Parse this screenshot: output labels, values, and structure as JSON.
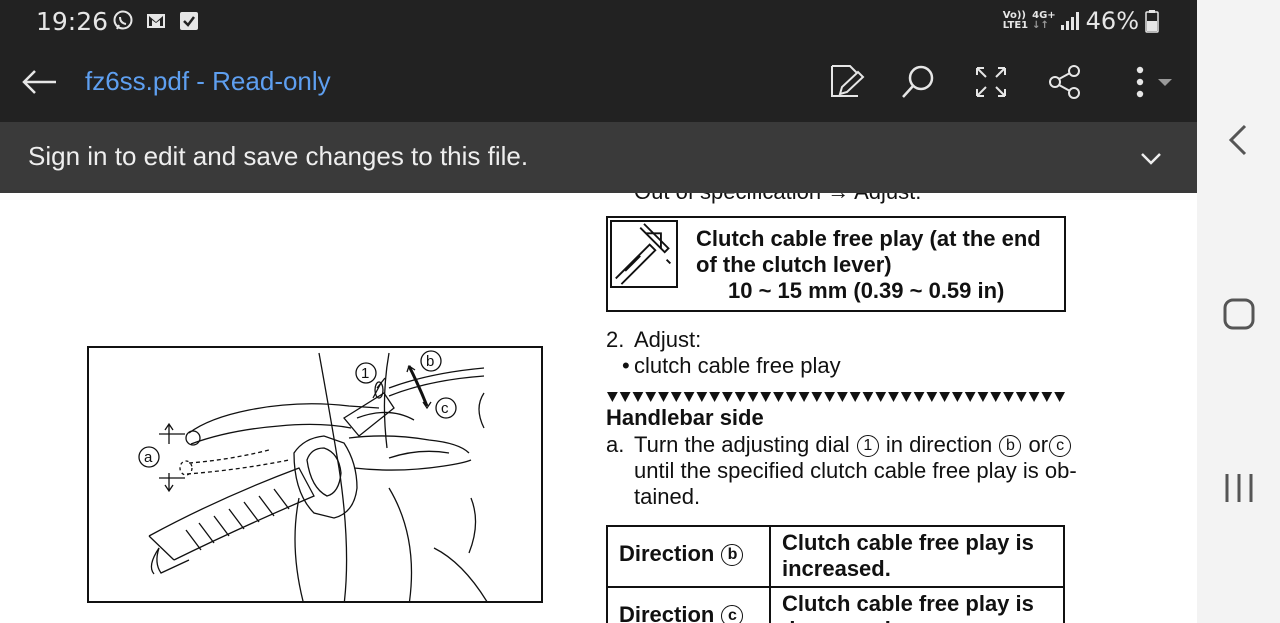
{
  "status_bar": {
    "time": "19:26",
    "network_top": "Vo))",
    "network_bottom": "LTE1",
    "network_type": "4G+",
    "battery_percent": "46%",
    "icons": [
      "viber-icon",
      "gmail-icon",
      "checkbox-notification-icon",
      "signal-icon",
      "battery-icon"
    ]
  },
  "toolbar": {
    "title": "fz6ss.pdf - Read-only",
    "title_color": "#5e9ff0",
    "icons": [
      "back-arrow-icon",
      "edit-pen-icon",
      "search-icon",
      "fullscreen-icon",
      "share-icon",
      "more-options-icon"
    ]
  },
  "banner": {
    "text": "Sign in to edit and save changes to this file.",
    "icon": "chevron-down-icon"
  },
  "document": {
    "cutoff_text": "Out of specification → Adjust.",
    "spec": {
      "title": "Clutch cable free play (at the end of the clutch lever)",
      "value": "10 ~ 15 mm (0.39 ~ 0.59 in)"
    },
    "step2": {
      "number": "2.",
      "text": "Adjust:",
      "bullet": "clutch cable free play"
    },
    "handlebar_heading": "Handlebar side",
    "step_a": {
      "label": "a.",
      "line1_part1": "Turn the adjusting dial",
      "dial_marker": "1",
      "line1_part2": "in direction",
      "direction_b": "b",
      "or_text": "or",
      "direction_c": "c",
      "line2": "until the specified clutch cable free play is ob-",
      "line3": "tained."
    },
    "table": {
      "rows": [
        {
          "direction": "Direction",
          "marker": "b",
          "result": "Clutch cable free play is increased."
        },
        {
          "direction": "Direction",
          "marker": "c",
          "result": "Clutch cable free play is decreased."
        }
      ]
    },
    "figure_labels": {
      "a": "a",
      "one": "1",
      "b": "b",
      "c": "c"
    }
  },
  "nav_bar": {
    "icons": [
      "back-chevron-icon",
      "home-icon",
      "recents-icon"
    ]
  }
}
